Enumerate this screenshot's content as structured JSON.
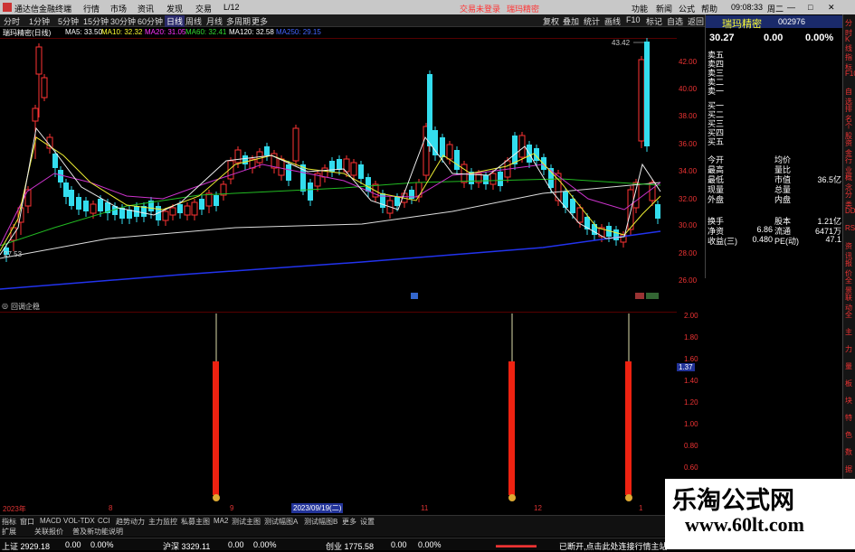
{
  "titlebar": {
    "app": "通达信金融终端",
    "items": [
      "行情",
      "市场",
      "资讯",
      "发现",
      "交易",
      "L/12"
    ],
    "center_items": [
      "交易未登录",
      "瑞玛精密"
    ],
    "right_items": [
      "功能",
      "新闻",
      "公式",
      "帮助"
    ],
    "time": "09:08:33",
    "weekday": "周二"
  },
  "menu": {
    "periods": [
      "分时",
      "1分钟",
      "5分钟",
      "15分钟",
      "30分钟",
      "60分钟",
      "日线",
      "周线",
      "月线",
      "多周期",
      "更多"
    ],
    "active": "日线",
    "right": [
      "复权",
      "叠加",
      "统计",
      "画线",
      "F10",
      "标记",
      "自选",
      "返回"
    ]
  },
  "legend": {
    "name": "瑞玛精密(日线)",
    "ma5": "MA5: 33.50",
    "ma10": "MA10: 32.32",
    "ma20": "MA20: 31.05",
    "ma60": "MA60: 32.41",
    "ma120": "MA120: 32.58",
    "ma250": "MA250: 29.15"
  },
  "price_scale": [
    "42.00",
    "40.00",
    "38.00",
    "36.00",
    "34.00",
    "32.00",
    "30.00",
    "28.00",
    "26.00"
  ],
  "chart_labels": {
    "high": "43.42",
    "low": "27.53"
  },
  "indicator": {
    "title": "回调企稳",
    "scale": [
      "2.00",
      "1.80",
      "1.60",
      "1.40",
      "1.20",
      "1.00",
      "0.80",
      "0.60"
    ],
    "marker": "1.37"
  },
  "dates": [
    "2023年",
    "8",
    "9",
    "2023/09/19(二)",
    "11",
    "12",
    "1"
  ],
  "tabs": [
    "指标",
    "窗口",
    "MACD",
    "VOL-TDX",
    "CCI",
    "趋势动力",
    "主力监控",
    "私募主图",
    "MA2",
    "测试主图",
    "测试幅图A",
    "测试幅图B",
    "更多",
    "设置"
  ],
  "tabs2": [
    "扩展",
    "关联报价",
    "普及新功能说明"
  ],
  "panel": {
    "name": "瑞玛精密",
    "code": "002976",
    "price": "30.27",
    "change": "0.00",
    "pct": "0.00%",
    "sells": [
      "卖五",
      "卖四",
      "卖三",
      "卖二",
      "卖一"
    ],
    "buys": [
      "买一",
      "买二",
      "买三",
      "买四",
      "买五"
    ],
    "stats": [
      [
        "今开",
        "",
        "均价",
        ""
      ],
      [
        "最高",
        "",
        "量比",
        ""
      ],
      [
        "最低",
        "",
        "市值",
        "36.5亿"
      ],
      [
        "现量",
        "",
        "总量",
        ""
      ],
      [
        "外盘",
        "",
        "内盘",
        ""
      ]
    ],
    "stats2": [
      [
        "换手",
        "",
        "股本",
        "1.21亿"
      ],
      [
        "净资",
        "6.86",
        "流通",
        "6471万"
      ],
      [
        "收益(三)",
        "0.480",
        "PE(动)",
        "47.1"
      ]
    ]
  },
  "statusbar": {
    "sh": "上证 2929.18",
    "sh_chg": "0.00",
    "sh_pct": "0.00%",
    "hs": "沪深 3329.11",
    "hs_chg": "0.00",
    "hs_pct": "0.00%",
    "cy": "创业 1775.58",
    "cy_chg": "0.00",
    "cy_pct": "0.00%",
    "msg": "已断开,点击此处连接行情主站"
  },
  "watermark": {
    "line1": "乐淘公式网",
    "line2": "www.60lt.com"
  },
  "sidebar": [
    "分时",
    "K线",
    "指标",
    "F10",
    "自选",
    "排名",
    "个股",
    "资金",
    "行业",
    "概念",
    "分类",
    "DDE",
    "RSI",
    "资讯",
    "报价",
    "全景",
    "联动",
    "全",
    "主",
    "力",
    "量",
    "板",
    "块",
    "特",
    "色",
    "数",
    "据",
    "自",
    "定"
  ],
  "chart_data": {
    "type": "candlestick",
    "indicator_signals": [
      {
        "value": 1.37
      },
      {
        "value": 1.37
      },
      {
        "value": 1.37
      }
    ]
  }
}
